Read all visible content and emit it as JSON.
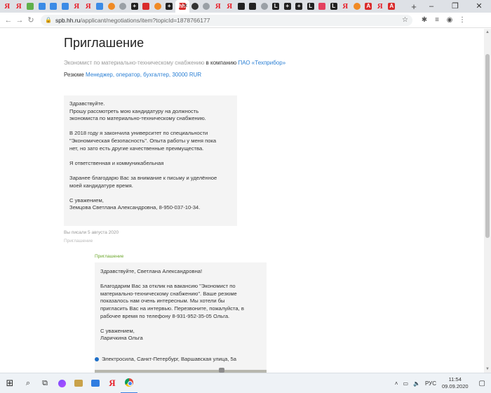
{
  "tabs": [
    {
      "icon": "yandex-icon",
      "glyph": "Я",
      "kind": "ya"
    },
    {
      "icon": "yandex-icon",
      "glyph": "Я",
      "kind": "ya"
    },
    {
      "icon": "green-app-icon",
      "glyph": "",
      "kind": "green"
    },
    {
      "icon": "chat-icon",
      "glyph": "",
      "kind": "blue"
    },
    {
      "icon": "chat-icon",
      "glyph": "",
      "kind": "blue"
    },
    {
      "icon": "chat-icon",
      "glyph": "",
      "kind": "blue"
    },
    {
      "icon": "yandex-icon",
      "glyph": "Я",
      "kind": "ya"
    },
    {
      "icon": "yandex-icon",
      "glyph": "Я",
      "kind": "ya"
    },
    {
      "icon": "vk-icon",
      "glyph": "",
      "kind": "blue"
    },
    {
      "icon": "orange-icon",
      "glyph": "",
      "kind": "orange"
    },
    {
      "icon": "site-icon",
      "glyph": "",
      "kind": "grey"
    },
    {
      "icon": "plus-square-icon",
      "glyph": "+",
      "kind": "black"
    },
    {
      "icon": "hh-icon",
      "glyph": "",
      "kind": "red"
    },
    {
      "icon": "mail-icon",
      "glyph": "",
      "kind": "orange"
    },
    {
      "icon": "plus-square-icon",
      "glyph": "+",
      "kind": "black"
    },
    {
      "icon": "hh-icon",
      "glyph": "hh",
      "kind": "red",
      "active": true
    },
    {
      "icon": "globe-icon",
      "glyph": "",
      "kind": "dark"
    },
    {
      "icon": "site-icon",
      "glyph": "",
      "kind": "grey"
    },
    {
      "icon": "yandex-icon",
      "glyph": "Я",
      "kind": "ya"
    },
    {
      "icon": "yandex-icon",
      "glyph": "Я",
      "kind": "ya"
    },
    {
      "icon": "grid-icon",
      "glyph": "",
      "kind": "black"
    },
    {
      "icon": "grid-icon",
      "glyph": "",
      "kind": "black"
    },
    {
      "icon": "site-icon",
      "glyph": "",
      "kind": "grey"
    },
    {
      "icon": "l-icon",
      "glyph": "L",
      "kind": "black"
    },
    {
      "icon": "plus-square-icon",
      "glyph": "+",
      "kind": "black"
    },
    {
      "icon": "plus-square-icon",
      "glyph": "+",
      "kind": "black"
    },
    {
      "icon": "l-icon",
      "glyph": "L",
      "kind": "black"
    },
    {
      "icon": "instagram-icon",
      "glyph": "",
      "kind": "pink"
    },
    {
      "icon": "l-icon",
      "glyph": "L",
      "kind": "black"
    },
    {
      "icon": "yandex-icon",
      "glyph": "Я",
      "kind": "ya"
    },
    {
      "icon": "mail-icon",
      "glyph": "",
      "kind": "orange"
    },
    {
      "icon": "a-icon",
      "glyph": "A",
      "kind": "red"
    },
    {
      "icon": "yandex-icon",
      "glyph": "Я",
      "kind": "ya"
    },
    {
      "icon": "a-icon",
      "glyph": "A",
      "kind": "red"
    }
  ],
  "window": {
    "minimize": "–",
    "maximize": "❐",
    "close": "✕",
    "new_tab": "+"
  },
  "address": {
    "host": "spb.hh.ru",
    "path": "/applicant/negotiations/item?topicId=1878766177"
  },
  "page": {
    "title": "Приглашение",
    "vacancy_title": "Экономист по материально-техническому снабжению",
    "in_company": "в компанию",
    "company": "ПАО «Техприбор»",
    "resume_label": "Резюме",
    "resume_link": "Менеджер, оператор, бухгалтер, 30000 RUR"
  },
  "message": {
    "lines": [
      "Здравствуйте.",
      "Прошу рассмотреть мою кандидатуру на должность",
      "экономиста по материально-техническому снабжению.",
      "",
      "В 2018 году я закончила университет по специальности",
      "\"Экономическая безопасность\". Опыта работы у меня пока",
      "нет, но зато есть другие качественные преимущества.",
      "",
      "Я ответственная и коммуникабельная",
      "",
      "Заранее благодарю Вас за внимание к письму и уделённое",
      "моей кандидатуре время.",
      "",
      "С уважением,",
      "Земцова Светлана Александровна, 8-950-037-10-34."
    ],
    "sent": "Вы писали 5 августа 2020",
    "status": "Приглашение"
  },
  "reply": {
    "label": "Приглашение",
    "lines": [
      "Здравствуйте, Светлана Александровна!",
      "",
      "Благодарим Вас за отклик на вакансию \"Экономист по",
      "материально-техническому снабжению\". Ваше резюме",
      "показалось нам очень интересным. Мы хотели бы",
      "пригласить Вас на интервью. Перезвоните, пожалуйста, в",
      "рабочее время по телефону 8-931-952-35-05 Ольга.",
      "",
      "С уважением,",
      "Ларичкина Ольга"
    ],
    "address": "Электросила, Санкт-Петербург, Варшавская улица, 5а"
  },
  "taskbar": {
    "lang": "РУС",
    "time": "11:54",
    "date": "09.09.2020"
  }
}
